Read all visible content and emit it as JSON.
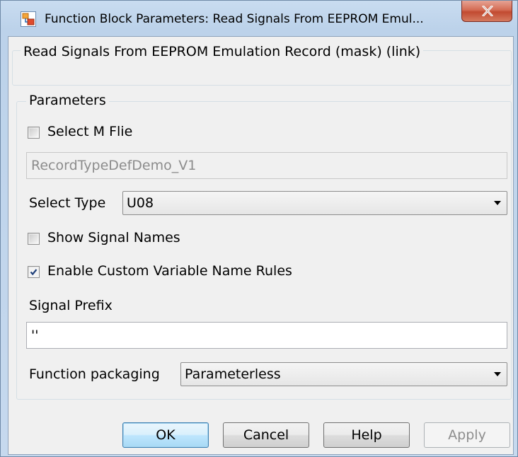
{
  "window": {
    "title": "Function Block Parameters: Read Signals From EEPROM Emul..."
  },
  "description": {
    "title": "Read Signals From EEPROM Emulation Record  (mask) (link)"
  },
  "parameters": {
    "title": "Parameters",
    "select_m_file": {
      "label": "Select M Flie",
      "checked": false
    },
    "m_file_value": "RecordTypeDefDemo_V1",
    "select_type": {
      "label": "Select Type",
      "value": "U08"
    },
    "show_signal_names": {
      "label": "Show Signal Names",
      "checked": false
    },
    "enable_custom_rules": {
      "label": "Enable Custom Variable Name Rules",
      "checked": true
    },
    "signal_prefix": {
      "label": "Signal Prefix",
      "value": "''"
    },
    "function_packaging": {
      "label": "Function packaging",
      "value": "Parameterless"
    }
  },
  "buttons": {
    "ok": "OK",
    "cancel": "Cancel",
    "help": "Help",
    "apply": "Apply"
  },
  "icons": {
    "app": "simulink-block-icon",
    "close": "close-icon"
  },
  "colors": {
    "close_button": "#c14a31",
    "title_bar": "#bcd2ea",
    "default_button_border": "#3c7fb1"
  }
}
